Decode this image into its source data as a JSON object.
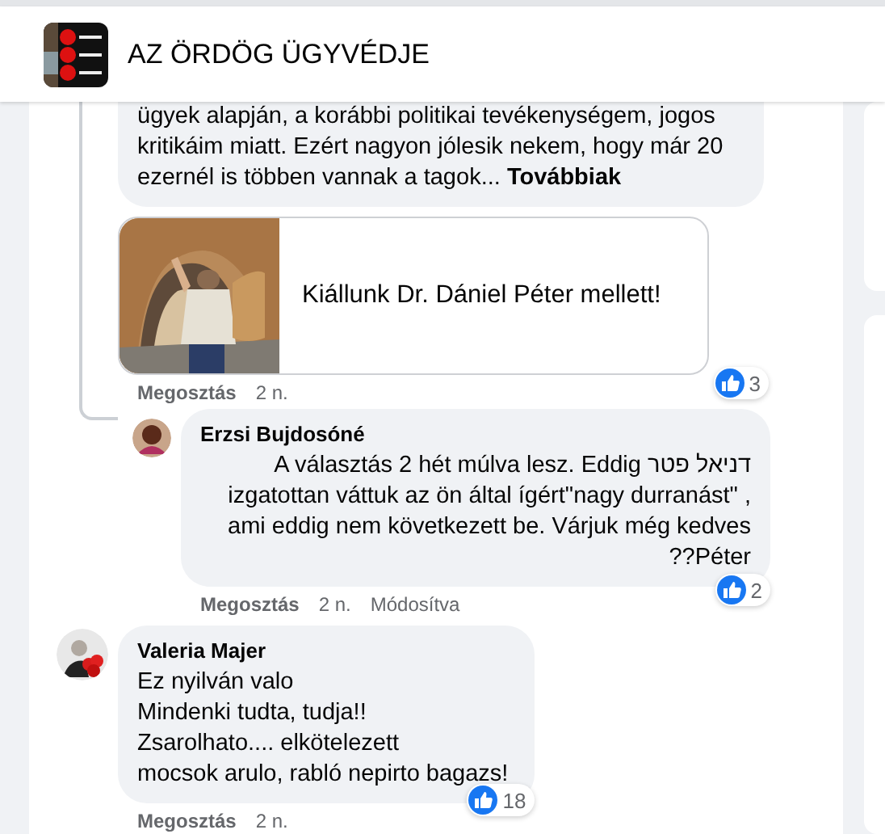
{
  "header": {
    "title": "AZ ÖRDÖG ÜGYVÉDJE"
  },
  "thread": {
    "text": "ügyek alapján, a korábbi politikai tevékenységem, jogos kritikáim miatt. Ezért nagyon jólesik nekem, hogy már 20 ezernél is többen vannak a tagok...",
    "more": "Továbbiak",
    "link_card": {
      "title": "Kiállunk Dr. Dániel Péter mellett!"
    },
    "reactions": "3",
    "share": "Megosztás",
    "time": "2 n.",
    "replies": [
      {
        "author": "Erzsi Bujdosóné",
        "text": "דניאל פטר A választás 2 hét múlva lesz. Eddig izgatottan váttuk az ön által ígért\"nagy durranást\" , ami eddig nem következett be. Várjuk még kedves Péter??",
        "rtl": true,
        "reactions": "2",
        "share": "Megosztás",
        "time": "2 n.",
        "edited": "Módosítva"
      }
    ]
  },
  "comments": [
    {
      "author": "Valeria Majer",
      "lines": [
        "Ez nyilván valo",
        "Mindenki tudta, tudja!!",
        "Zsarolhato.... elkötelezett",
        "mocsok arulo, rabló nepirto bagazs!"
      ],
      "reactions": "18",
      "share": "Megosztás",
      "time": "2 n."
    }
  ]
}
